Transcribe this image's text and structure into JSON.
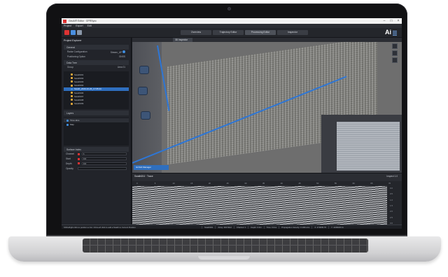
{
  "app": {
    "window_title": "GeoAI® Editor · GPRSync",
    "menu": [
      "Project",
      "Export",
      "Edit"
    ],
    "tabs": [
      {
        "label": "Overview",
        "active": false
      },
      {
        "label": "Trajectory Editor",
        "active": false
      },
      {
        "label": "Processing Editor",
        "active": true
      },
      {
        "label": "Inspector",
        "active": false
      }
    ],
    "logo_text": "Ai",
    "accent_color": "#2f6fbf"
  },
  "sidebar": {
    "header": "Project Explorer",
    "general_section": "General",
    "fields": [
      {
        "label": "Radar Configuration",
        "value": "Stream_UP"
      },
      {
        "label": "Positioning Option",
        "value": "GNSS"
      }
    ],
    "data_tree_section": "Data Tree",
    "group_label": "Group",
    "group_value": "Area 01",
    "tree_items": [
      {
        "label": "Swath001",
        "selected": false,
        "color": "#e0a73a"
      },
      {
        "label": "Swath002",
        "selected": false,
        "color": "#e0a73a"
      },
      {
        "label": "Swath003",
        "selected": false,
        "color": "#e0a73a"
      },
      {
        "label": "Swath004",
        "selected": false,
        "color": "#e0a73a"
      },
      {
        "label": "Swath_2020-10-26_17:05:44",
        "selected": true,
        "color": "#3e8de0"
      },
      {
        "label": "Swath006",
        "selected": false,
        "color": "#e0a73a"
      },
      {
        "label": "Swath007",
        "selected": false,
        "color": "#e0a73a"
      },
      {
        "label": "Swath008",
        "selected": false,
        "color": "#e0a73a"
      },
      {
        "label": "Swath009",
        "selected": false,
        "color": "#e0a73a"
      }
    ],
    "layers_section": "Layers",
    "layers": [
      {
        "label": "Time slice",
        "selected": true
      },
      {
        "label": "Map",
        "selected": false
      }
    ],
    "surface_section": "Surface Index",
    "surface_fields": [
      {
        "label": "Channel",
        "value": "1"
      },
      {
        "label": "Start",
        "value": "0.0"
      },
      {
        "label": "Depth",
        "value": "0.0"
      },
      {
        "label": "Opacity",
        "value": ""
      }
    ]
  },
  "map": {
    "tab_label": "3D Inspector",
    "selected_swath_label": "GCSAI Manager"
  },
  "profile": {
    "tab_label": "Swath004 · Trace",
    "view_label": "Inspect 1.0",
    "distance_ticks": [
      "0",
      "5",
      "10",
      "15",
      "20",
      "25",
      "30",
      "35",
      "40",
      "45",
      "50",
      "55",
      "60",
      "65",
      "70"
    ],
    "depth_ticks": [
      "0.0",
      "0.5",
      "1.0",
      "1.5",
      "2.0",
      "2.5",
      "3.0"
    ]
  },
  "statusbar": {
    "hint": "Shift+Right click to position a Cut. Ctrl+Left click to add a Swath to Current Position",
    "cells": [
      "Swath001",
      "Array: 400 MHz",
      "Channel: 1",
      "Depth: 0.0m",
      "Time: 0.0ns",
      "Propagation Velocity: 0.100m/ns",
      "X: 474845.76",
      "Y: 4198230.11"
    ]
  }
}
